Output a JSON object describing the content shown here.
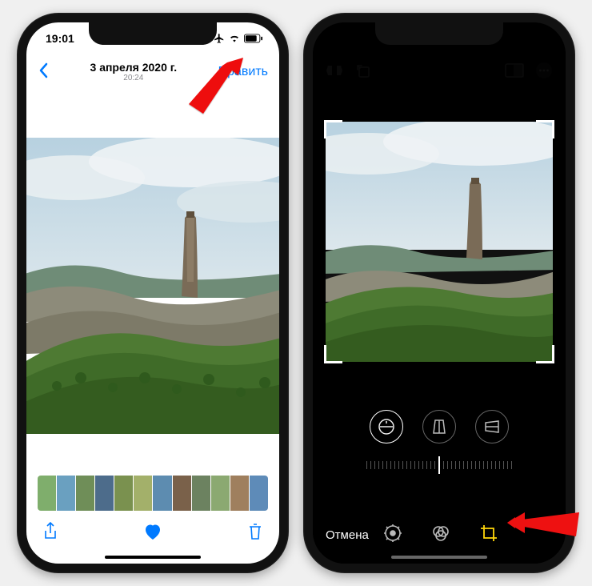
{
  "left": {
    "status": {
      "time": "19:01"
    },
    "nav": {
      "date": "3 апреля 2020 г.",
      "time": "20:24",
      "edit_label": "Править"
    }
  },
  "right": {
    "edit_toolbar": {
      "cancel_label": "Отмена"
    }
  },
  "icons": {
    "airplane": "airplane-icon",
    "wifi": "wifi-icon",
    "battery": "battery-icon",
    "back": "chevron-left-icon",
    "share": "share-icon",
    "heart": "heart-icon",
    "trash": "trash-icon",
    "flip_h": "flip-horizontal-icon",
    "rotate": "rotate-icon",
    "aspect": "aspect-ratio-icon",
    "more": "ellipsis-icon",
    "straighten": "straighten-icon",
    "persp_v": "perspective-vertical-icon",
    "persp_h": "perspective-horizontal-icon",
    "adjust": "adjust-icon",
    "filters": "filters-icon",
    "crop": "crop-icon"
  }
}
